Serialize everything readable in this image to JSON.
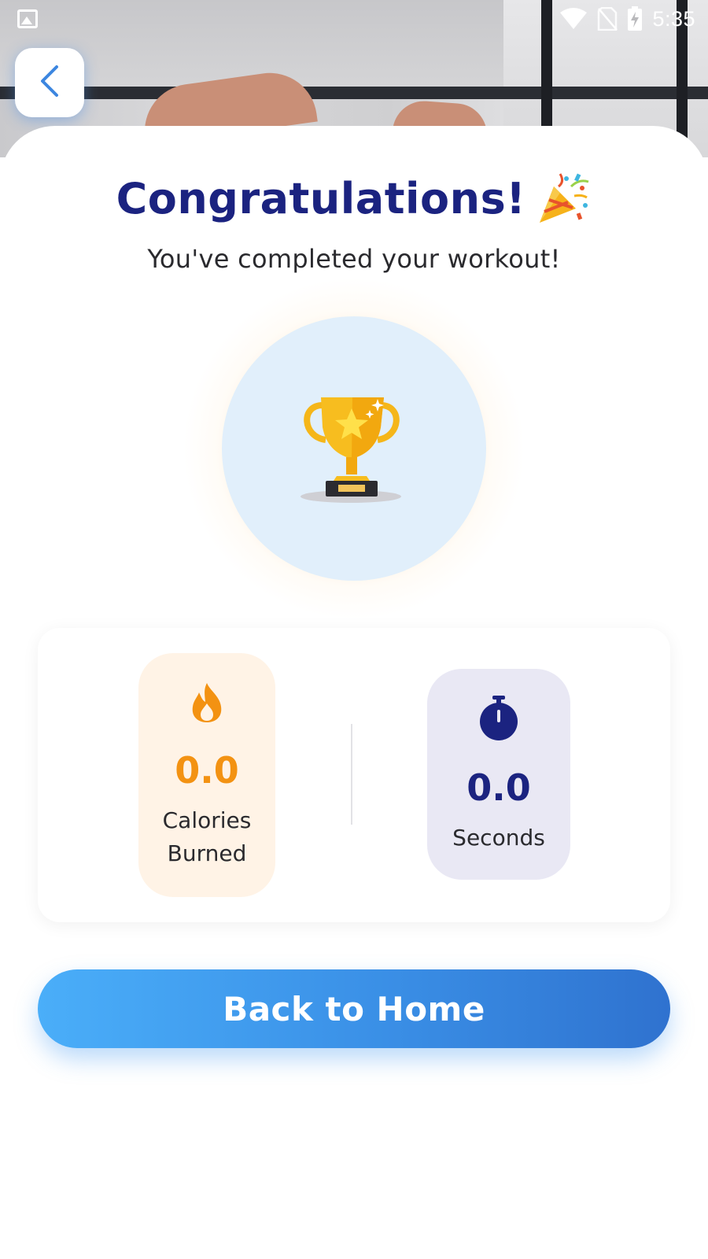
{
  "status_bar": {
    "time": "5:35",
    "icons": [
      "photo-icon",
      "wifi-icon",
      "no-sim-icon",
      "battery-charging-icon"
    ]
  },
  "header": {
    "back_icon": "chevron-left-icon"
  },
  "main": {
    "title": "Congratulations!",
    "title_icon": "party-popper-icon",
    "subtitle": "You've completed your workout!",
    "trophy_icon": "trophy-icon"
  },
  "stats": {
    "calories": {
      "icon": "flame-icon",
      "value": "0.0",
      "label": "Calories Burned",
      "accent_color": "#f39212"
    },
    "time": {
      "icon": "stopwatch-icon",
      "value": "0.0",
      "label": "Seconds",
      "accent_color": "#1b2380"
    }
  },
  "actions": {
    "home_button_label": "Back to Home"
  },
  "colors": {
    "title": "#1b2380",
    "button_gradient_start": "#4aaef9",
    "button_gradient_end": "#2f72cf",
    "trophy_circle_bg": "#e1effb",
    "calories_card_bg": "#fff3e6",
    "time_card_bg": "#e9e8f4"
  }
}
